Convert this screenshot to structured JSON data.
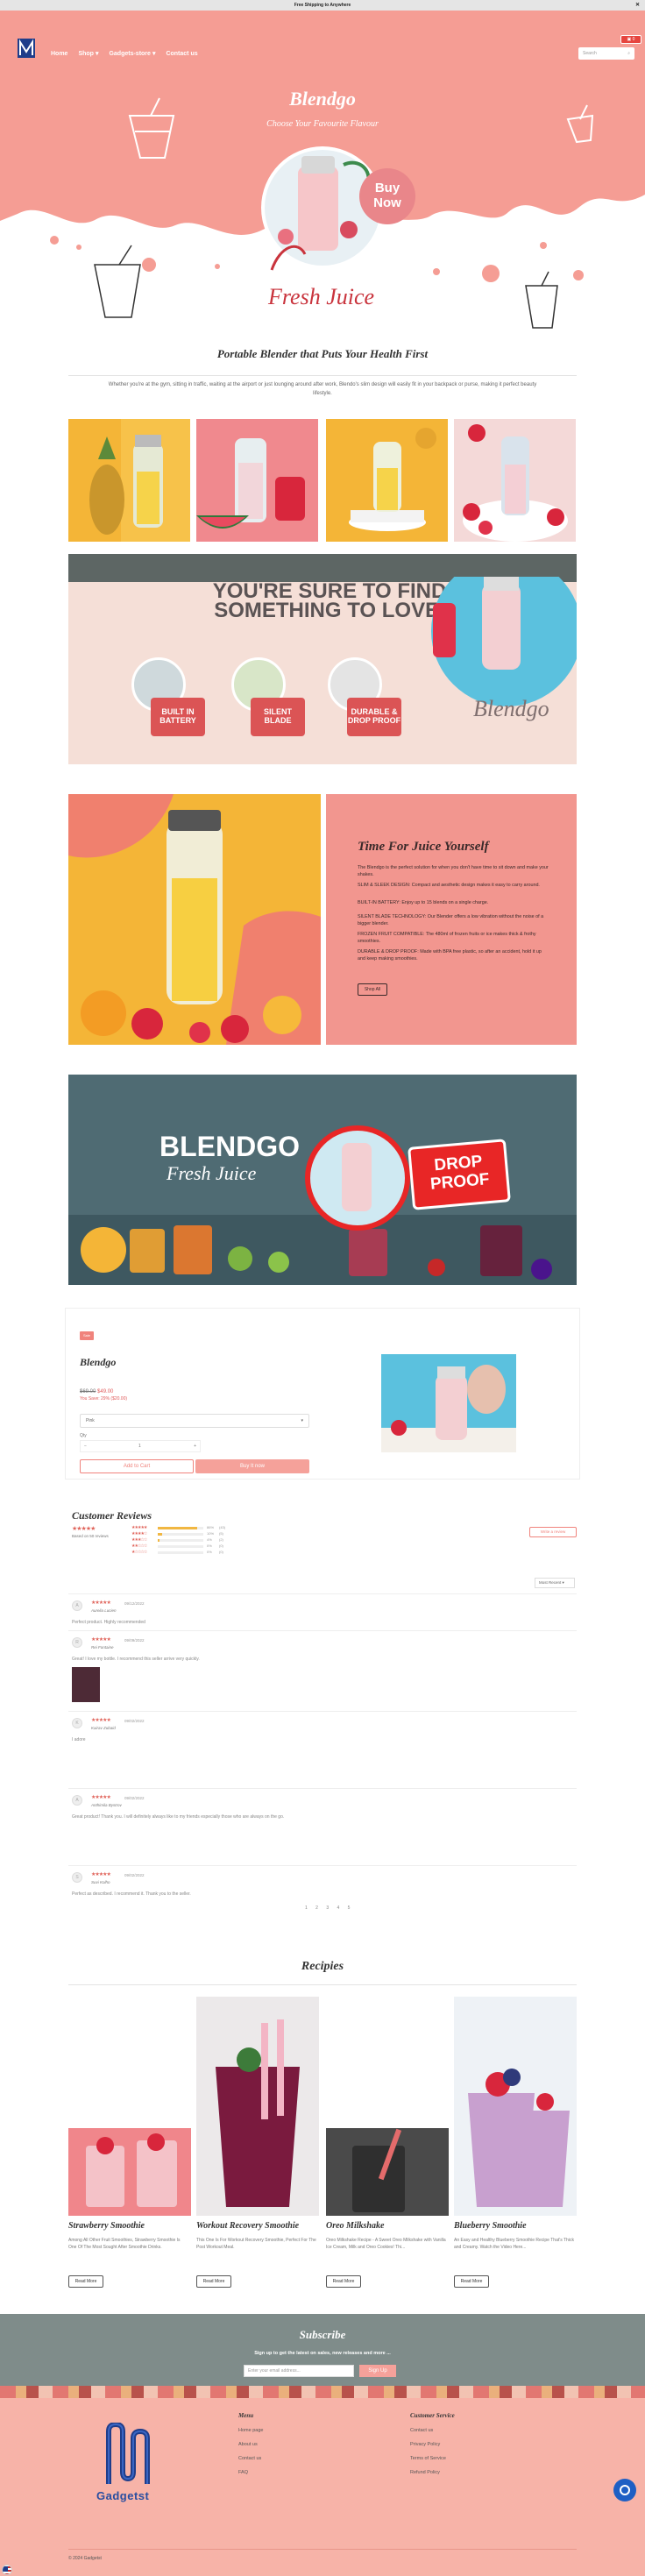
{
  "announcement": "Free Shipping to Anywhere",
  "nav": {
    "links": [
      "Home",
      "Shop",
      "Gadgets-store",
      "Contact us"
    ],
    "search_placeholder": "Search",
    "cart_count": "0"
  },
  "hero": {
    "title": "Blendgo",
    "subtitle": "Choose Your Favourite Flavour",
    "buy_now": "Buy Now",
    "script": "Fresh Juice"
  },
  "intro": {
    "title": "Portable Blender that Puts Your Health First",
    "text": "Whether you're at the gym, sitting in traffic, waiting at the airport or just lounging around after work, Blendo's slim design will easily fit in your backpack or purse, making it perfect beauty lifestyle."
  },
  "banner": {
    "headline_1": "YOU'RE SURE TO FIND",
    "headline_2": "SOMETHING TO LOVE.",
    "features": [
      "BUILT IN BATTERY",
      "SILENT BLADE",
      "DURABLE & DROP PROOF"
    ],
    "script": "Blendgo"
  },
  "juice": {
    "title": "Time For Juice Yourself",
    "paragraphs": [
      "The Blendgo is the perfect solution for when you don't have time to sit down and make your shakes.",
      "SLIM & SLEEK DESIGN: Compact and aesthetic design makes it easy to carry around.",
      "BUILT-IN BATTERY: Enjoy up to 15 blends on a single charge.",
      "SILENT BLADE TECHNOLOGY: Our Blender offers a low vibration without the noise of a bigger blender.",
      "FROZEN FRUIT COMPATIBLE: The 480ml of frozen fruits or ice makes thick & frothy smoothies.",
      "DURABLE & DROP PROOF: Made with BPA free plastic, so after an accident, hold it up and keep making smoothies."
    ],
    "button": "Shop All"
  },
  "drop_banner": {
    "title": "BLENDGO",
    "script": "Fresh Juice",
    "badge": "DROP PROOF"
  },
  "product": {
    "badge": "Sale",
    "title": "Blendgo",
    "price": "$49.00",
    "compare_price": "$69.00",
    "save": "You Save: 29% ($20.00)",
    "variant": "Pink",
    "quantity_label": "Qty",
    "quantity": "1",
    "add_to_cart": "Add to Cart",
    "buy_now": "Buy It now"
  },
  "reviews": {
    "title": "Customer Reviews",
    "summary": "Based on 50 reviews",
    "write": "Write a review",
    "sort": "Most Recent",
    "breakdown": [
      {
        "stars": 5,
        "percent": 0.86,
        "pct_label": "86%",
        "count": "(43)"
      },
      {
        "stars": 4,
        "percent": 0.1,
        "pct_label": "10%",
        "count": "(5)"
      },
      {
        "stars": 3,
        "percent": 0.04,
        "pct_label": "4%",
        "count": "(2)"
      },
      {
        "stars": 2,
        "percent": 0.0,
        "pct_label": "0%",
        "count": "(0)"
      },
      {
        "stars": 1,
        "percent": 0.0,
        "pct_label": "0%",
        "count": "(0)"
      }
    ],
    "items": [
      {
        "initial": "A",
        "date": "09/12/2022",
        "name": "Aurelia Lucien",
        "text": "Perfect product. Highly recommended"
      },
      {
        "initial": "R",
        "date": "09/09/2022",
        "name": "Rei Fontaine",
        "text": "Great! I love my bottle. I recommend this seller arrive very quickly."
      },
      {
        "initial": "K",
        "date": "09/02/2022",
        "name": "Kairav Zubaid",
        "text": "I adore"
      },
      {
        "initial": "A",
        "date": "09/02/2022",
        "name": "Anthimila Bystrov",
        "text": "Great product! Thank you. I will definitely always like to my friends especially those who are always on the go."
      },
      {
        "initial": "S",
        "date": "09/02/2022",
        "name": "Suvi Kolho",
        "text": "Perfect as described. I recommend it. Thank you to the seller."
      }
    ],
    "pager": "1 2 3 4 5"
  },
  "recipes": {
    "title": "Recipies",
    "items": [
      {
        "name": "Strawberry Smoothie",
        "desc": "Among All Other Fruit Smoothies, Strawberry Smoothie Is One Of The Most Sought After Smoothie Drinks.",
        "button": "Read More"
      },
      {
        "name": "Workout Recovery Smoothie",
        "desc": "This One Is For Workout Recovery Smoothie, Perfect For The Post Workout Meal.",
        "button": "Read More"
      },
      {
        "name": "Oreo Milkshake",
        "desc": "Oreo Milkshake Recipe - A Sweet Oreo Milkshake with Vanilla Ice Cream, Milk and Oreo Cookies! Thi...",
        "button": "Read More"
      },
      {
        "name": "Blueberry Smoothie",
        "desc": "An Easy and Healthy Blueberry Smoothie Recipe That's Thick and Creamy. Watch the Video Here...",
        "button": "Read More"
      }
    ]
  },
  "subscribe": {
    "title": "Subscribe",
    "text": "Sign up to get the latest on sales, new releases and more ...",
    "placeholder": "Enter your email address...",
    "button": "Sign Up"
  },
  "footer": {
    "brand": "Gadgetst",
    "menu_title": "Menu",
    "menu": [
      "Home page",
      "About us",
      "Contact us",
      "FAQ"
    ],
    "service_title": "Customer Service",
    "service": [
      "Contact us",
      "Privacy Policy",
      "Terms of Service",
      "Refund Policy"
    ],
    "copyright": "© 2024 Gadgetst"
  },
  "colors": {
    "coral": "#f2968f",
    "accent_red": "#e6453f",
    "footer_bg": "#f7b3a8",
    "subscribe_bg": "#7f8c8a",
    "brand_blue": "#2a4ea0"
  }
}
